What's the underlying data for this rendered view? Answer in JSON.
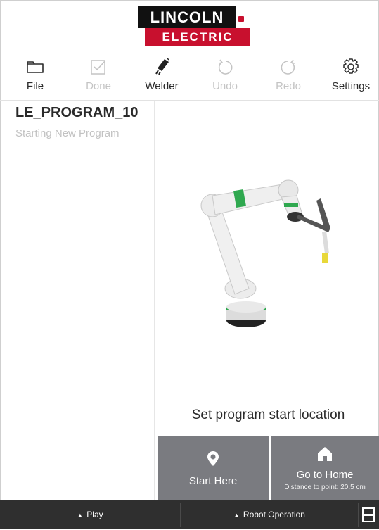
{
  "logo": {
    "line1": "LINCOLN",
    "line2": "ELECTRIC",
    "colors": {
      "black": "#111111",
      "red": "#c8102e"
    }
  },
  "toolbar": {
    "items": [
      {
        "label": "File",
        "icon": "folder-icon",
        "enabled": true
      },
      {
        "label": "Done",
        "icon": "checkbox-icon",
        "enabled": false
      },
      {
        "label": "Welder",
        "icon": "welder-icon",
        "enabled": true
      },
      {
        "label": "Undo",
        "icon": "undo-icon",
        "enabled": false
      },
      {
        "label": "Redo",
        "icon": "redo-icon",
        "enabled": false
      },
      {
        "label": "Settings",
        "icon": "gear-icon",
        "enabled": true
      }
    ]
  },
  "sidebar": {
    "program_name": "LE_PROGRAM_10",
    "status": "Starting New Program"
  },
  "main": {
    "prompt": "Set program start location",
    "start_here": {
      "label": "Start Here",
      "icon": "location-pin-icon"
    },
    "go_home": {
      "label": "Go to Home",
      "icon": "home-icon",
      "distance": "Distance to point: 20.5 cm"
    }
  },
  "bottombar": {
    "play": "Play",
    "robot_operation": "Robot Operation",
    "right_icon": "panel-icon"
  },
  "colors": {
    "button_bg": "#7a7b80",
    "bottombar_bg": "#2f2f2f",
    "robot_accent": "#2fa84f"
  }
}
